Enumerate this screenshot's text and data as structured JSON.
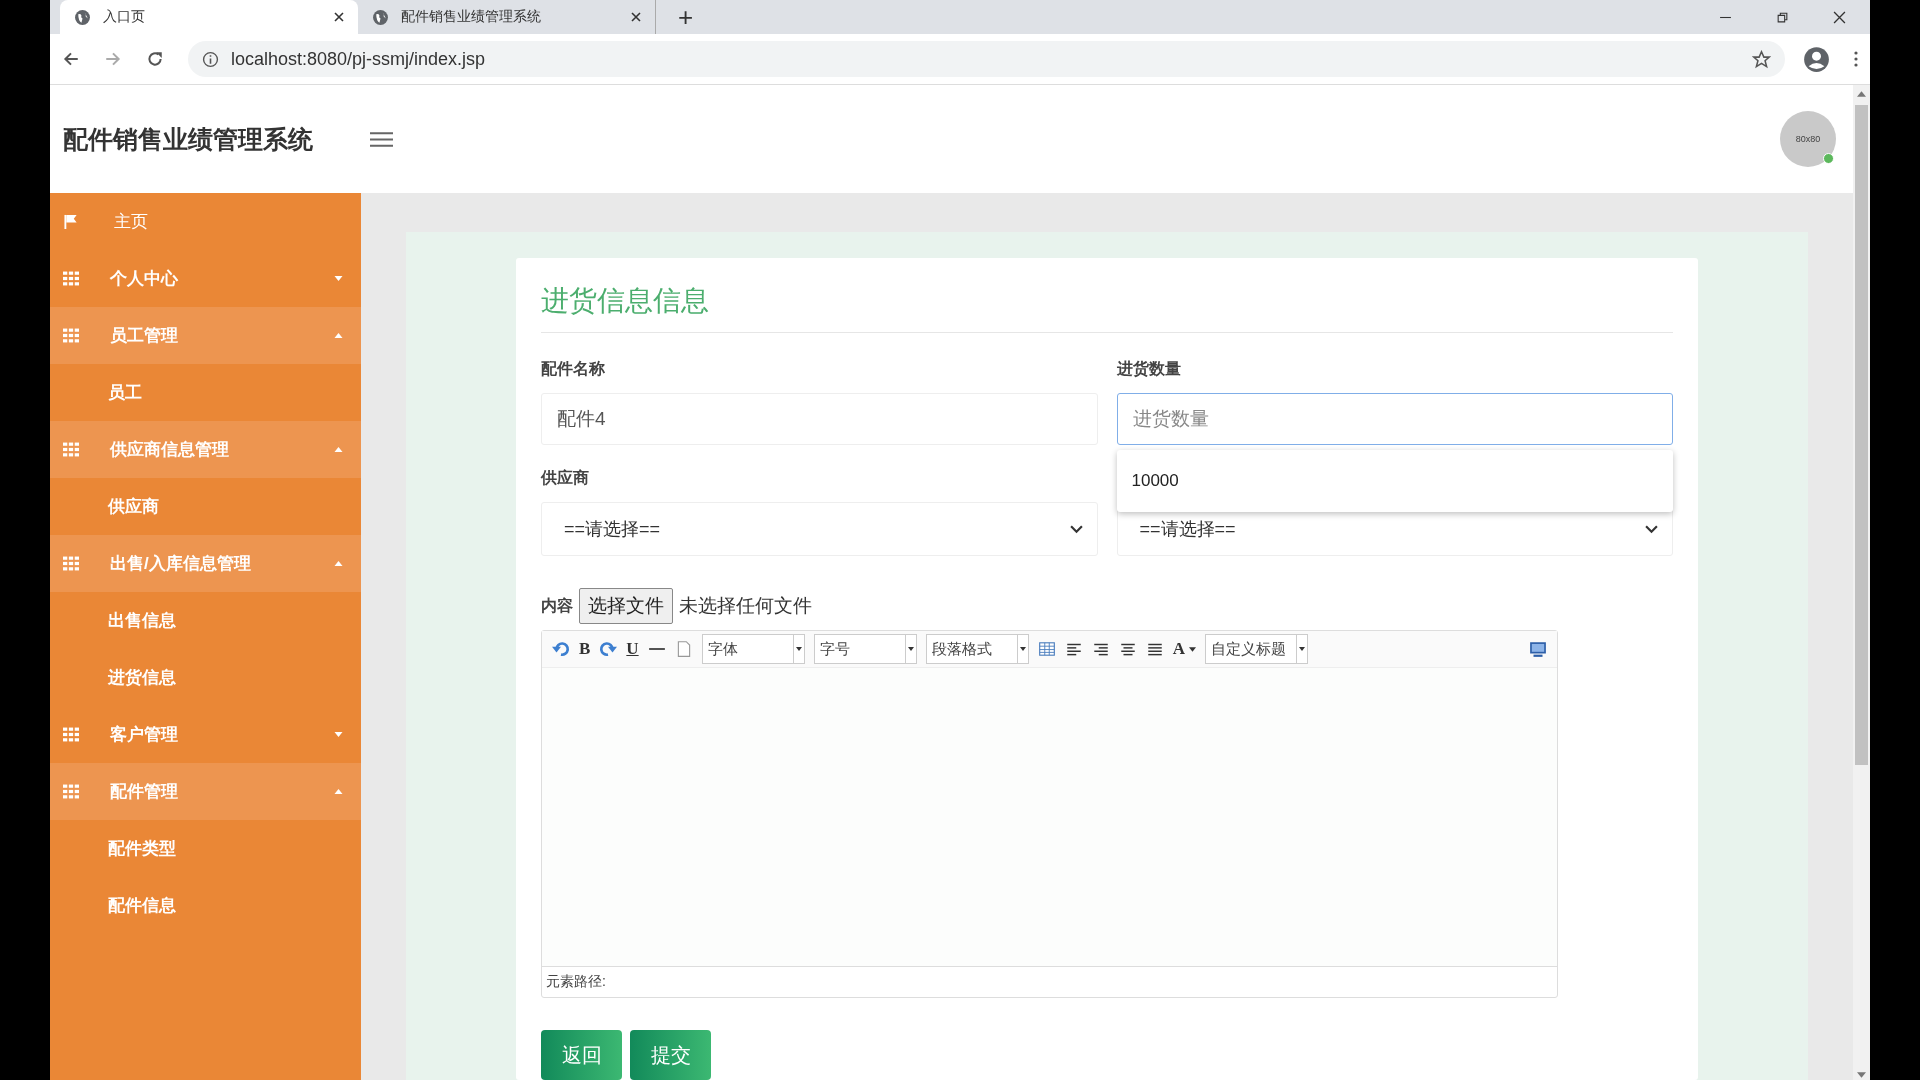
{
  "browser": {
    "tabs": [
      {
        "title": "入口页",
        "selected": true
      },
      {
        "title": "配件销售业绩管理系统",
        "selected": false
      }
    ],
    "new_tab": "+",
    "url": "localhost:8080/pj-ssmj/index.jsp"
  },
  "header": {
    "title": "配件销售业绩管理系统",
    "avatar": "80x80",
    "online": true
  },
  "sidebar": {
    "items": [
      {
        "kind": "link",
        "label": "主页"
      },
      {
        "kind": "group",
        "label": "个人中心",
        "expanded": false
      },
      {
        "kind": "group",
        "label": "员工管理",
        "expanded": true,
        "children": [
          {
            "label": "员工"
          }
        ]
      },
      {
        "kind": "group",
        "label": "供应商信息管理",
        "expanded": true,
        "children": [
          {
            "label": "供应商"
          }
        ]
      },
      {
        "kind": "group",
        "label": "出售/入库信息管理",
        "expanded": true,
        "children": [
          {
            "label": "出售信息"
          },
          {
            "label": "进货信息"
          }
        ]
      },
      {
        "kind": "group",
        "label": "客户管理",
        "expanded": false
      },
      {
        "kind": "group",
        "label": "配件管理",
        "expanded": true,
        "children": [
          {
            "label": "配件类型"
          },
          {
            "label": "配件信息"
          }
        ]
      }
    ]
  },
  "form": {
    "title": "进货信息信息",
    "fields": [
      {
        "kind": "text",
        "label": "配件名称",
        "value": "配件4",
        "focused": false
      },
      {
        "kind": "text",
        "label": "进货数量",
        "placeholder": "进货数量",
        "focused": true,
        "suggestions": [
          "10000"
        ]
      },
      {
        "kind": "select",
        "label": "供应商",
        "value": "==请选择=="
      },
      {
        "kind": "select",
        "value": "==请选择=="
      }
    ],
    "content": {
      "label": "内容",
      "file_button": "选择文件",
      "file_status": "未选择任何文件",
      "toolbar": [
        {
          "kind": "undo"
        },
        {
          "kind": "glyph",
          "text": "B"
        },
        {
          "kind": "redo"
        },
        {
          "kind": "glyph",
          "text": "U",
          "underline": true
        },
        {
          "kind": "hr"
        },
        {
          "kind": "page"
        },
        {
          "kind": "select",
          "text": "字体"
        },
        {
          "kind": "select",
          "text": "字号"
        },
        {
          "kind": "select",
          "text": "段落格式"
        },
        {
          "kind": "table"
        },
        {
          "kind": "align-left"
        },
        {
          "kind": "align-right"
        },
        {
          "kind": "align-center"
        },
        {
          "kind": "justify"
        },
        {
          "kind": "glyph",
          "text": "A",
          "menu": true
        },
        {
          "kind": "select",
          "text": "自定义标题"
        },
        {
          "kind": "preview"
        }
      ],
      "status": "元素路径:"
    },
    "buttons": [
      "返回",
      "提交"
    ]
  }
}
